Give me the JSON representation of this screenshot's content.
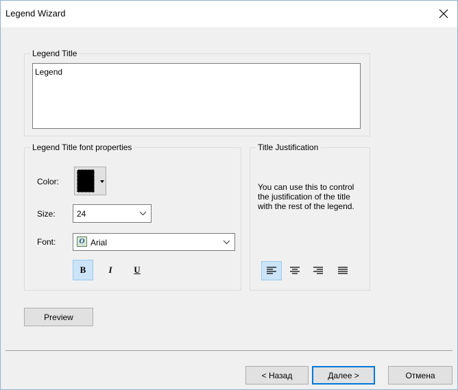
{
  "window": {
    "title": "Legend Wizard"
  },
  "legend_title_group": {
    "label": "Legend Title",
    "value": "Legend"
  },
  "font_group": {
    "label": "Legend Title font properties",
    "color_label": "Color:",
    "color_value": "#000000",
    "size_label": "Size:",
    "size_value": "24",
    "font_label": "Font:",
    "font_value": "Arial",
    "bold": "B",
    "italic": "I",
    "underline": "U",
    "active_style": "bold"
  },
  "justification_group": {
    "label": "Title Justification",
    "description": "You can use this to control the justification of the title with the rest of the legend.",
    "options": [
      "align-left-icon",
      "align-center-icon",
      "align-right-icon",
      "justify-icon"
    ],
    "selected": "align-left-icon"
  },
  "buttons": {
    "preview": "Preview",
    "back": "< Назад",
    "next": "Далее >",
    "cancel": "Отмена"
  },
  "colors": {
    "accent": "#0078d7",
    "selected_bg": "#cce4f7"
  }
}
